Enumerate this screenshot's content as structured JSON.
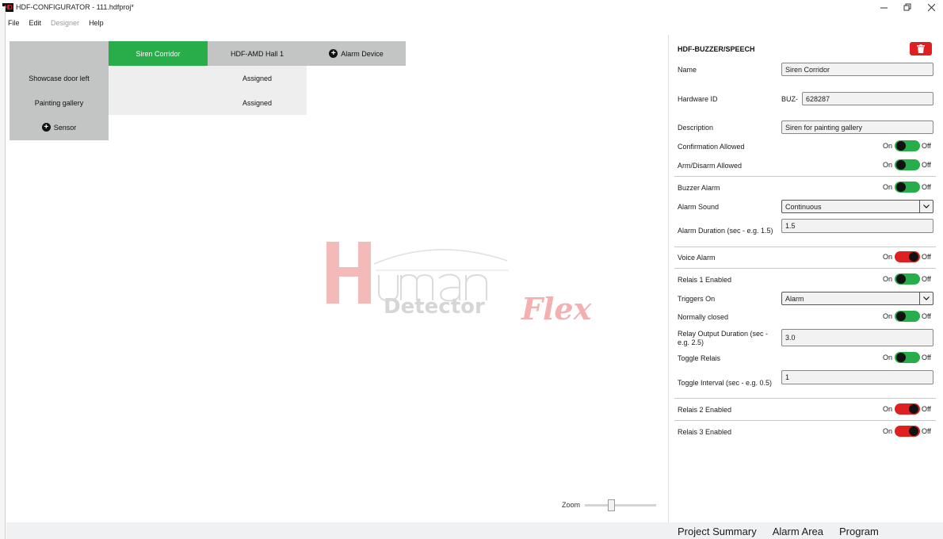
{
  "window": {
    "title": "HDF-CONFIGURATOR - 111.hdfproj*",
    "logo_text": "HD"
  },
  "menu": [
    {
      "label": "File",
      "disabled": false
    },
    {
      "label": "Edit",
      "disabled": false
    },
    {
      "label": "Designer",
      "disabled": true
    },
    {
      "label": "Help",
      "disabled": false
    }
  ],
  "matrix": {
    "columns": [
      "Siren Corridor",
      "HDF-AMD Hall 1"
    ],
    "add_alarm_device": "Alarm Device",
    "rows": [
      {
        "label": "Showcase door left",
        "cells": [
          "",
          "Assigned"
        ]
      },
      {
        "label": "Painting gallery",
        "cells": [
          "",
          "Assigned"
        ]
      }
    ],
    "add_sensor": "Sensor"
  },
  "zoom": {
    "label": "Zoom",
    "level": 0.36
  },
  "panel": {
    "title": "HDF-BUZZER/SPEECH",
    "name": {
      "label": "Name",
      "value": "Siren Corridor"
    },
    "hardware_id": {
      "label": "Hardware ID",
      "prefix": "BUZ-",
      "value": "628287"
    },
    "description": {
      "label": "Description",
      "value": "Siren for painting gallery"
    },
    "toggle_on": "On",
    "toggle_off": "Off",
    "confirmation": {
      "label": "Confirmation Allowed",
      "state": "off"
    },
    "arm_disarm": {
      "label": "Arm/Disarm Allowed",
      "state": "off"
    },
    "buzzer_alarm": {
      "label": "Buzzer Alarm",
      "state": "off"
    },
    "alarm_sound": {
      "label": "Alarm Sound",
      "value": "Continuous"
    },
    "alarm_duration": {
      "label": "Alarm Duration (sec - e.g. 1.5)",
      "value": "1.5"
    },
    "voice_alarm": {
      "label": "Voice Alarm",
      "state": "on"
    },
    "relais1": {
      "label": "Relais 1 Enabled",
      "state": "off"
    },
    "triggers_on": {
      "label": "Triggers On",
      "value": "Alarm"
    },
    "normally_closed": {
      "label": "Normally closed",
      "state": "off"
    },
    "relay_duration": {
      "label_line1": "Relay Output Duration (sec -",
      "label_line2": "e.g. 2.5)",
      "value": "3.0"
    },
    "toggle_relais": {
      "label": "Toggle Relais",
      "state": "off"
    },
    "toggle_interval": {
      "label": "Toggle Interval (sec - e.g. 0.5)",
      "value": "1"
    },
    "relais2": {
      "label": "Relais 2 Enabled",
      "state": "on"
    },
    "relais3": {
      "label": "Relais 3 Enabled",
      "state": "on"
    }
  },
  "bottom_tabs": [
    "Project Summary",
    "Alarm Area",
    "Program"
  ],
  "colors": {
    "active_column": "#27ae4a",
    "toggle_green": "#27ae4a",
    "toggle_red": "#e02020",
    "delete_button": "#e02020",
    "header_grey": "#c3c4c4"
  }
}
